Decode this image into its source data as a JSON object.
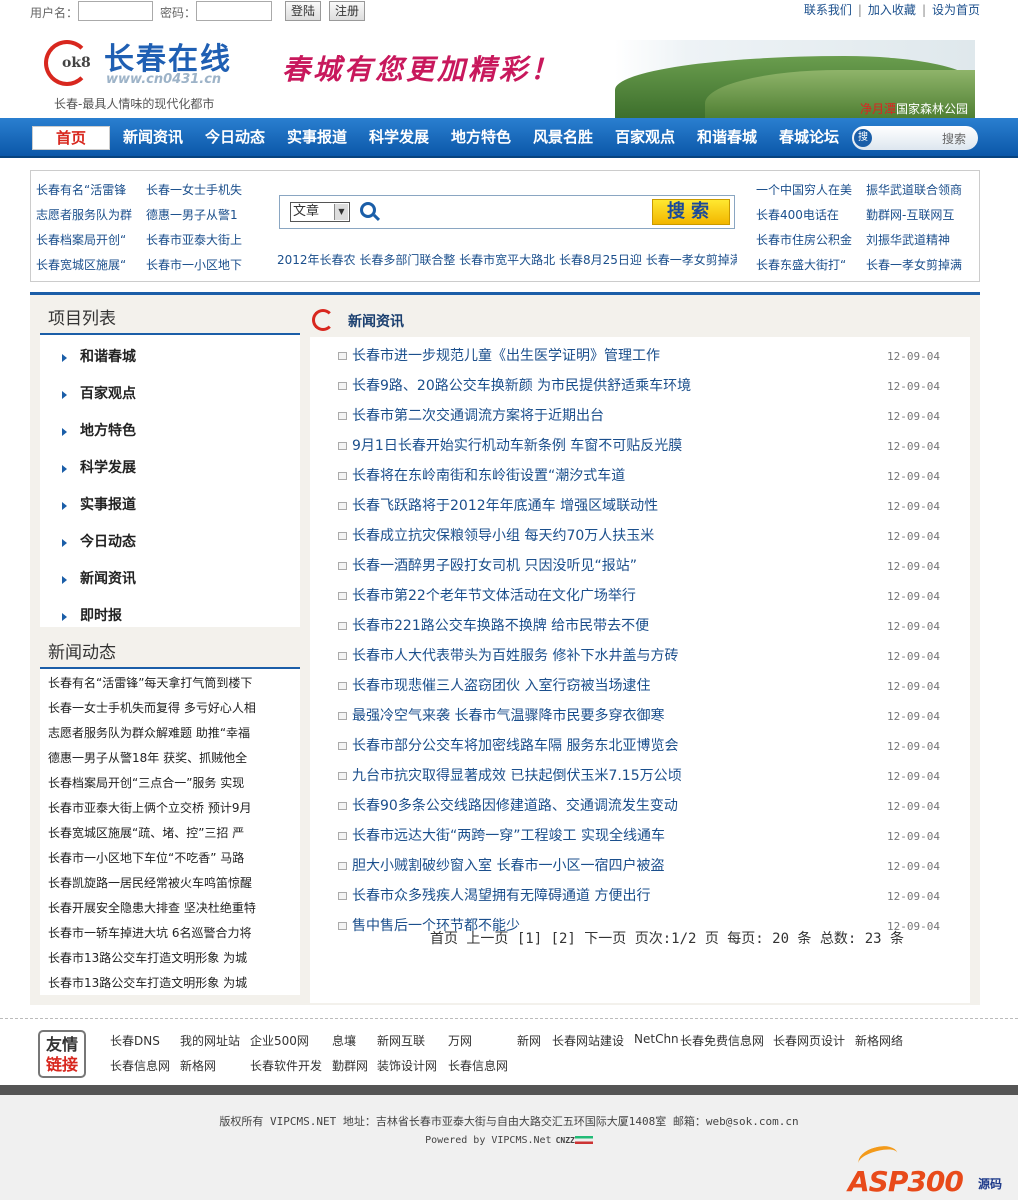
{
  "login": {
    "username_label": "用户名：",
    "password_label": "密码：",
    "login_button": "登陆",
    "register_button": "注册"
  },
  "top_links": [
    "联系我们",
    "加入收藏",
    "设为首页"
  ],
  "header": {
    "logo_number": "ok8",
    "site_name": "长春在线",
    "site_url": "www.cn0431.cn",
    "slogan": "长春-最具人情味的现代化都市",
    "banner_text": "春城有您更加精彩！",
    "banner_caption_red": "净月潭",
    "banner_caption": "国家森林公园"
  },
  "nav": {
    "items": [
      "首页",
      "新闻资讯",
      "今日动态",
      "实事报道",
      "科学发展",
      "地方特色",
      "风景名胜",
      "百家观点",
      "和谐春城",
      "春城论坛"
    ],
    "search_icon_text": "搜",
    "search_label": "搜索"
  },
  "quick_links": {
    "left": [
      "长春有名“活雷锋",
      "长春一女士手机失",
      "志愿者服务队为群",
      "德惠一男子从警1",
      "长春档案局开创“",
      "长春市亚泰大街上",
      "长春宽城区施展“",
      "长春市一小区地下"
    ],
    "right": [
      "一个中国穷人在美",
      "振华武道联合领商",
      "长春400电话在",
      "勤群网-互联网互",
      "长春市住房公积金",
      "刘振华武道精神",
      "长春东盛大街打“",
      "长春一孝女剪掉满"
    ],
    "search_select": "文章",
    "search_button": "搜索",
    "hotline": "2012年长春农 长春多部门联合整 长春市宽平大路北 长春8月25日迎 长春一孝女剪掉满"
  },
  "left_panel": {
    "project_title": "项目列表",
    "projects": [
      "和谐春城",
      "百家观点",
      "地方特色",
      "科学发展",
      "实事报道",
      "今日动态",
      "新闻资讯",
      "即时报"
    ],
    "news_title": "新闻动态",
    "news": [
      "长春有名“活雷锋”每天拿打气筒到楼下",
      "长春一女士手机失而复得 多亏好心人相",
      "志愿者服务队为群众解难题 助推“幸福",
      "德惠一男子从警18年 获奖、抓贼他全",
      "长春档案局开创“三点合一”服务 实现",
      "长春市亚泰大街上俩个立交桥 预计9月",
      "长春宽城区施展“疏、堵、控”三招 严",
      "长春市一小区地下车位“不吃香” 马路",
      "长春凯旋路一居民经常被火车鸣笛惊醒",
      "长春开展安全隐患大排查 坚决杜绝重特",
      "长春市一轿车掉进大坑 6名巡警合力将",
      "长春市13路公交车打造文明形象 为城",
      "长春市13路公交车打造文明形象 为城"
    ]
  },
  "right_panel": {
    "title": "新闻资讯",
    "items": [
      {
        "title": "长春市进一步规范儿童《出生医学证明》管理工作",
        "date": "12-09-04"
      },
      {
        "title": "长春9路、20路公交车换新颜 为市民提供舒适乘车环境",
        "date": "12-09-04"
      },
      {
        "title": "长春市第二次交通调流方案将于近期出台",
        "date": "12-09-04"
      },
      {
        "title": "9月1日长春开始实行机动车新条例 车窗不可贴反光膜",
        "date": "12-09-04"
      },
      {
        "title": "长春将在东岭南街和东岭街设置“潮汐式车道",
        "date": "12-09-04"
      },
      {
        "title": "长春飞跃路将于2012年年底通车 增强区域联动性",
        "date": "12-09-04"
      },
      {
        "title": "长春成立抗灾保粮领导小组 每天约70万人扶玉米",
        "date": "12-09-04"
      },
      {
        "title": "长春一酒醉男子殴打女司机 只因没听见“报站”",
        "date": "12-09-04"
      },
      {
        "title": "长春市第22个老年节文体活动在文化广场举行",
        "date": "12-09-04"
      },
      {
        "title": "长春市221路公交车换路不换牌 给市民带去不便",
        "date": "12-09-04"
      },
      {
        "title": "长春市人大代表带头为百姓服务 修补下水井盖与方砖",
        "date": "12-09-04"
      },
      {
        "title": "长春市现悲催三人盗窃团伙 入室行窃被当场逮住",
        "date": "12-09-04"
      },
      {
        "title": "最强冷空气来袭 长春市气温骤降市民要多穿衣御寒",
        "date": "12-09-04"
      },
      {
        "title": "长春市部分公交车将加密线路车隔 服务东北亚博览会",
        "date": "12-09-04"
      },
      {
        "title": "九台市抗灾取得显著成效 已扶起倒伏玉米7.15万公顷",
        "date": "12-09-04"
      },
      {
        "title": "长春90多条公交线路因修建道路、交通调流发生变动",
        "date": "12-09-04"
      },
      {
        "title": "长春市远达大街“两跨一穿”工程竣工 实现全线通车",
        "date": "12-09-04"
      },
      {
        "title": "胆大小贼割破纱窗入室 长春市一小区一宿四户被盗",
        "date": "12-09-04"
      },
      {
        "title": "长春市众多残疾人渴望拥有无障碍通道 方便出行",
        "date": "12-09-04"
      },
      {
        "title": "售中售后一个环节都不能少",
        "date": "12-09-04"
      }
    ],
    "pager": "首页 上一页 [1] [2] 下一页 页次:1/2 页 每页: 20 条 总数: 23 条"
  },
  "friends": {
    "badge_line1": "友情",
    "badge_line2": "链接",
    "row1": [
      "长春DNS",
      "我的网址站",
      "企业500网",
      "息壤",
      "新网互联",
      "万网",
      "新网",
      "长春网站建设",
      "NetChn",
      "长春免费信息网",
      "长春网页设计",
      "新格网络"
    ],
    "row2": [
      "长春信息网",
      "新格网",
      "长春软件开发",
      "勤群网",
      "装饰设计网",
      "长春信息网"
    ]
  },
  "footer": {
    "copyright": "版权所有 VIPCMS.NET 地址：吉林省长春市亚泰大街与自由大路交汇五环国际大厦1408室 邮箱：web@sok.com.cn",
    "powered": "Powered by VIPCMS.Net",
    "cnzz": "CNZZ",
    "asp_logo": "ASP300",
    "asp_logo_suffix": "源码"
  },
  "colors": {
    "nav_blue": "#0b57a8",
    "accent_red": "#d8271e",
    "link_blue": "#1b4f8c"
  }
}
